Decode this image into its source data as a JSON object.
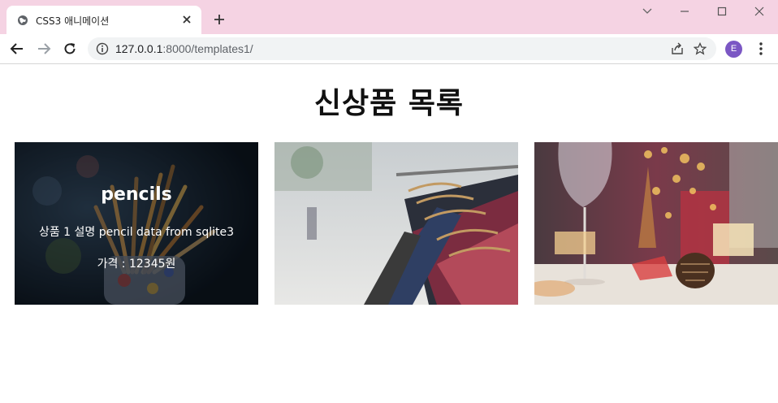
{
  "browser": {
    "tab_title": "CSS3 애니메이션",
    "url_host": "127.0.0.1",
    "url_path": ":8000/templates1/",
    "profile_initial": "E",
    "profile_color": "#7b57c4",
    "tabstrip_color": "#f5d3e3"
  },
  "page": {
    "heading": "신상품 목록",
    "products": [
      {
        "name": "pencils",
        "description": "상품 1 설명 pencil data from sqlite3",
        "price": "가격 : 12345원",
        "image": "pencils-photo"
      },
      {
        "image": "clothes-rack-photo"
      },
      {
        "image": "wine-glass-table-photo"
      }
    ]
  }
}
